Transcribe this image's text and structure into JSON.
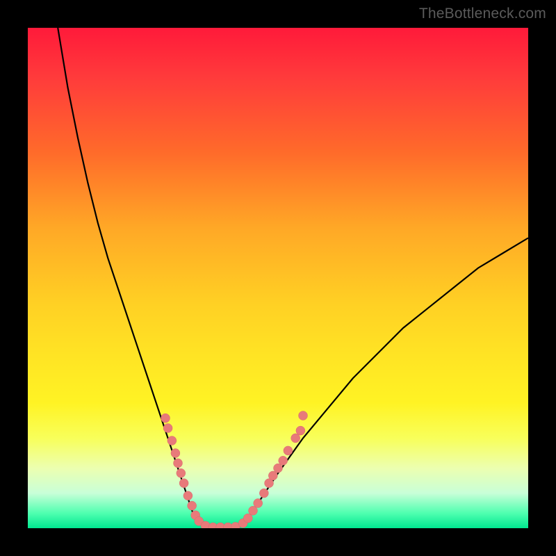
{
  "watermark": "TheBottleneck.com",
  "chart_data": {
    "type": "line",
    "title": "",
    "xlabel": "",
    "ylabel": "",
    "xlim": [
      0,
      100
    ],
    "ylim": [
      0,
      100
    ],
    "grid": false,
    "legend": false,
    "series": [
      {
        "name": "left-curve",
        "x": [
          6,
          8,
          10,
          12,
          14,
          16,
          18,
          20,
          22,
          24,
          26,
          28,
          30,
          32,
          33,
          34,
          35,
          36
        ],
        "y": [
          100,
          88,
          78,
          69,
          61,
          54,
          48,
          42,
          36,
          30,
          24,
          18,
          12,
          6,
          3,
          1.5,
          0.5,
          0
        ]
      },
      {
        "name": "flat-bottom",
        "x": [
          36,
          37,
          38,
          39,
          40,
          41,
          42
        ],
        "y": [
          0,
          0,
          0,
          0,
          0,
          0,
          0
        ]
      },
      {
        "name": "right-curve",
        "x": [
          42,
          44,
          46,
          48,
          50,
          55,
          60,
          65,
          70,
          75,
          80,
          85,
          90,
          95,
          100
        ],
        "y": [
          0,
          2,
          5,
          8,
          11,
          18,
          24,
          30,
          35,
          40,
          44,
          48,
          52,
          55,
          58
        ]
      }
    ],
    "scatter_points": {
      "name": "dots",
      "points": [
        {
          "x": 27.5,
          "y": 22
        },
        {
          "x": 28,
          "y": 20
        },
        {
          "x": 28.8,
          "y": 17.5
        },
        {
          "x": 29.5,
          "y": 15
        },
        {
          "x": 30,
          "y": 13
        },
        {
          "x": 30.6,
          "y": 11
        },
        {
          "x": 31.2,
          "y": 9
        },
        {
          "x": 32,
          "y": 6.5
        },
        {
          "x": 32.8,
          "y": 4.5
        },
        {
          "x": 33.5,
          "y": 2.6
        },
        {
          "x": 34.2,
          "y": 1.4
        },
        {
          "x": 35.5,
          "y": 0.5
        },
        {
          "x": 37,
          "y": 0.2
        },
        {
          "x": 38.5,
          "y": 0.2
        },
        {
          "x": 40,
          "y": 0.2
        },
        {
          "x": 41.5,
          "y": 0.3
        },
        {
          "x": 43,
          "y": 1.0
        },
        {
          "x": 44,
          "y": 2.0
        },
        {
          "x": 45,
          "y": 3.5
        },
        {
          "x": 46,
          "y": 5.0
        },
        {
          "x": 47.2,
          "y": 7.0
        },
        {
          "x": 48.2,
          "y": 9.0
        },
        {
          "x": 49,
          "y": 10.5
        },
        {
          "x": 50,
          "y": 12.0
        },
        {
          "x": 51,
          "y": 13.5
        },
        {
          "x": 52,
          "y": 15.5
        },
        {
          "x": 53.5,
          "y": 18.0
        },
        {
          "x": 54.5,
          "y": 19.5
        },
        {
          "x": 55,
          "y": 22.5
        }
      ]
    }
  }
}
